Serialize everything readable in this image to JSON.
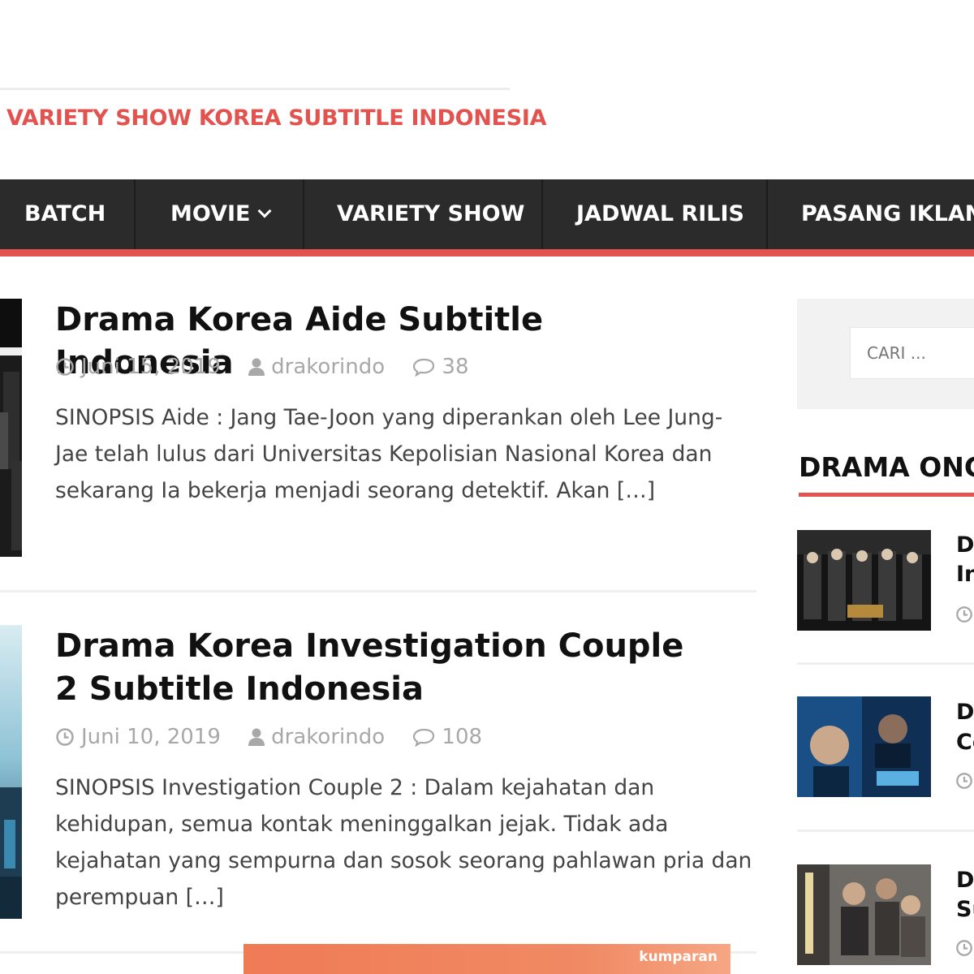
{
  "header": {
    "tagline": "VARIETY SHOW KOREA SUBTITLE INDONESIA"
  },
  "nav": {
    "items": [
      {
        "label": "BATCH"
      },
      {
        "label": "MOVIE",
        "has_dropdown": true
      },
      {
        "label": "VARIETY SHOW"
      },
      {
        "label": "JADWAL RILIS"
      },
      {
        "label": "PASANG IKLAN"
      }
    ]
  },
  "posts": [
    {
      "title": "Drama Korea Aide Subtitle Indonesia",
      "date": "Juni 15, 2019",
      "author": "drakorindo",
      "comments": "38",
      "excerpt": "SINOPSIS Aide : Jang Tae-Joon yang diperankan oleh Lee Jung-Jae telah lulus dari Universitas Kepolisian Nasional Korea dan sekarang Ia bekerja menjadi seorang detektif. Akan […]"
    },
    {
      "title": "Drama Korea Investigation Couple 2 Subtitle Indonesia",
      "date": "Juni 10, 2019",
      "author": "drakorindo",
      "comments": "108",
      "excerpt": "SINOPSIS Investigation Couple 2 : Dalam kejahatan dan kehidupan, semua kontak meninggalkan jejak. Tidak ada kejahatan yang sempurna dan sosok seorang pahlawan pria dan perempuan […]"
    }
  ],
  "sidebar": {
    "search_placeholder": "CARI ...",
    "widget_title": "DRAMA ONGO",
    "items": [
      {
        "line1": "D",
        "line2": "In"
      },
      {
        "line1": "D",
        "line2": "Co"
      },
      {
        "line1": "D",
        "line2": "Su"
      }
    ]
  },
  "ad": {
    "brand": "kumparan"
  },
  "colors": {
    "accent": "#e2534f",
    "nav_bg": "#2b2b2b",
    "meta": "#a8a8a8"
  }
}
